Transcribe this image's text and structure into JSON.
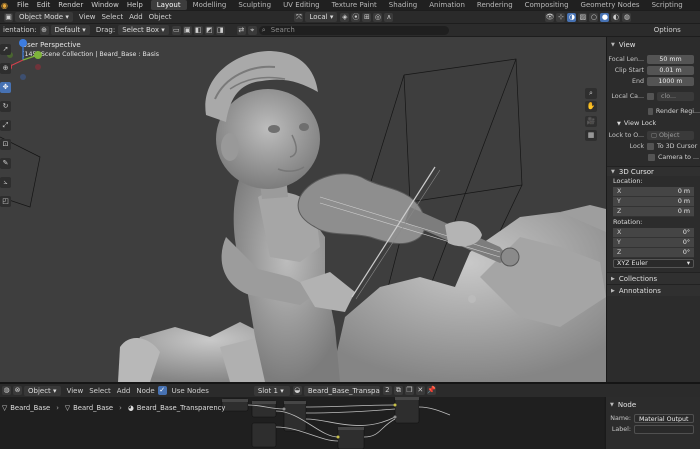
{
  "menubar": {
    "menus": [
      "File",
      "Edit",
      "Render",
      "Window",
      "Help"
    ],
    "workspaces": [
      "Layout",
      "Modelling",
      "Sculpting",
      "UV Editing",
      "Texture Paint",
      "Shading",
      "Animation",
      "Rendering",
      "Compositing",
      "Geometry Nodes",
      "Scripting"
    ],
    "active_workspace": "Layout"
  },
  "viewport_header": {
    "mode": "Object Mode",
    "menus": [
      "View",
      "Select",
      "Add",
      "Object"
    ],
    "transform_orientation": "Local"
  },
  "tool_header": {
    "orientation_label": "ientation:",
    "orientation_value": "Default",
    "drag_label": "Drag:",
    "drag_value": "Select Box",
    "search_placeholder": "Search",
    "options_label": "Options"
  },
  "viewport": {
    "perspective_label": "User Perspective",
    "collection_label": "(145) Scene Collection | Beard_Base : Basis"
  },
  "npanel": {
    "view_title": "View",
    "focal_length_label": "Focal Len...",
    "focal_length_value": "50 mm",
    "clip_start_label": "Clip Start",
    "clip_start_value": "0.01 m",
    "clip_end_label": "End",
    "clip_end_value": "1000 m",
    "local_camera_label": "Local Ca...",
    "local_camera_value": "clo...",
    "render_region_label": "Render Regi...",
    "view_lock_title": "View Lock",
    "lock_to_object_label": "Lock to O...",
    "lock_to_object_placeholder": "Object",
    "lock_label": "Lock",
    "to_3d_cursor_label": "To 3D Cursor",
    "camera_to_view_label": "Camera to ...",
    "cursor_title": "3D Cursor",
    "location_label": "Location:",
    "location": [
      {
        "axis": "X",
        "value": "0 m"
      },
      {
        "axis": "Y",
        "value": "0 m"
      },
      {
        "axis": "Z",
        "value": "0 m"
      }
    ],
    "rotation_label": "Rotation:",
    "rotation": [
      {
        "axis": "X",
        "value": "0°"
      },
      {
        "axis": "Y",
        "value": "0°"
      },
      {
        "axis": "Z",
        "value": "0°"
      }
    ],
    "rotation_mode": "XYZ Euler",
    "collections_title": "Collections",
    "annotations_title": "Annotations"
  },
  "node_header": {
    "editor_type": "Object",
    "menus": [
      "View",
      "Select",
      "Add",
      "Node"
    ],
    "use_nodes_label": "Use Nodes",
    "slot_value": "Slot 1",
    "material_name": "Beard_Base_Transparency",
    "user_count": "2"
  },
  "node_breadcrumb": {
    "object": "Beard_Base",
    "mesh": "Beard_Base",
    "material": "Beard_Base_Transparency"
  },
  "node_panel": {
    "title": "Node",
    "name_label": "Name:",
    "name_value": "Material Output",
    "label_label": "Label:",
    "label_value": ""
  },
  "colors": {
    "accent_blue": "#4772b3",
    "viewport_bg": "#3e3e3e",
    "panel_bg": "#2c2c2c",
    "gizmo_x": "#d2404c",
    "gizmo_y": "#7eb33a",
    "gizmo_z": "#3d7de0"
  }
}
